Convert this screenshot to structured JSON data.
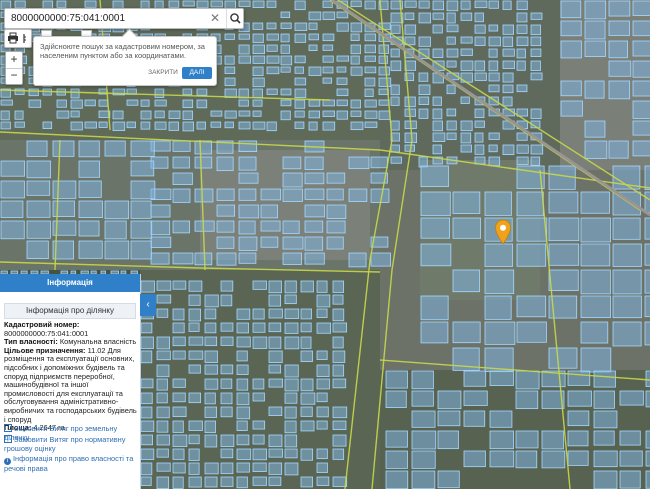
{
  "search": {
    "value": "8000000000:75:041:0001",
    "clear_icon": "close-icon",
    "button_icon": "search-icon"
  },
  "tooltip": {
    "text": "Здійсноюте пошук за кадастровим номером, за населеним пунктом або за координатами.",
    "close_label": "ЗАКРИТИ",
    "next_label": "ДАЛІ"
  },
  "zoom": {
    "in_label": "+",
    "out_label": "−"
  },
  "panel": {
    "header": "Інформація",
    "subheader": "Інформація про ділянку",
    "fields": {
      "cadastral_label": "Кадастровий номер:",
      "cadastral_value": "8000000000:75:041:0001",
      "ownership_label": "Тип власності:",
      "ownership_value": "Комунальна власність",
      "purpose_label": "Цільове призначення:",
      "purpose_value": "11.02 Для розміщення та експлуатації основних, підсобних і допоміжних будівель та споруд підприємств переробної, машинобудівної та іншої промисловості для експлуатації та обслуговування адміністративно-виробничих та господарських будівель і споруд",
      "area_label": "Площа:",
      "area_value": "4.2647 га"
    },
    "links": [
      "Замовити Витяг про земельну ділянку",
      "Замовити Витяг про нормативну грошову оцінку",
      "Інформація про право власності та речові права"
    ]
  },
  "colors": {
    "parcel_fill": "#7fb2de",
    "parcel_stroke": "#9cd3ff",
    "road": "#c8d84a",
    "panel_accent": "#2f80c9",
    "marker": "#f0a21a"
  }
}
